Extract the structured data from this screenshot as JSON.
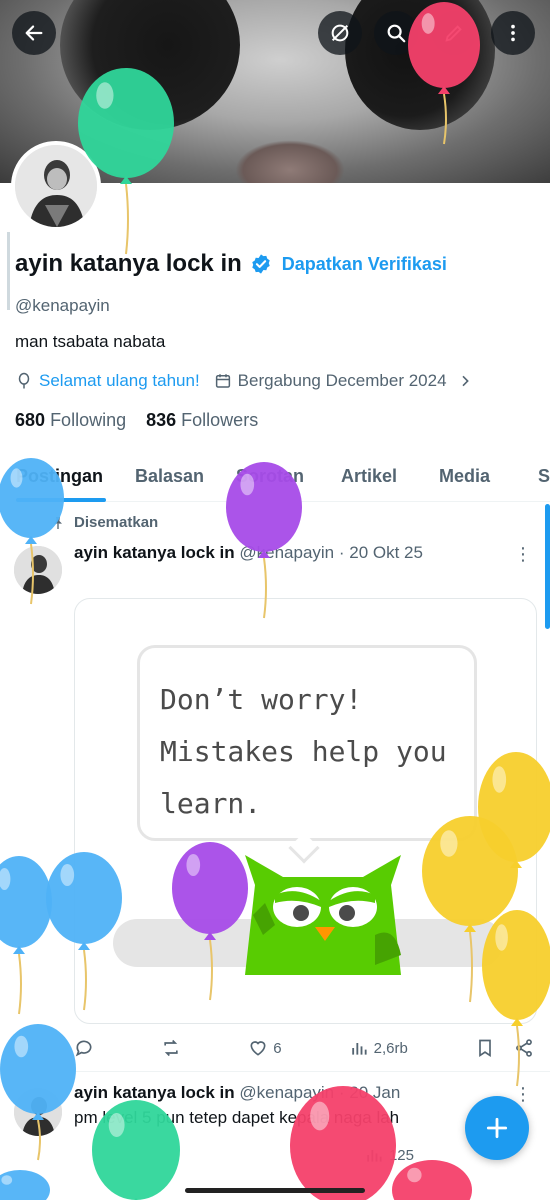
{
  "profile": {
    "name": "ayin katanya lock in",
    "verify_link": "Dapatkan Verifikasi",
    "handle": "@kenapayin",
    "bio": "man tsabata nabata",
    "birthday": "Selamat ulang tahun!",
    "joined": "Bergabung December 2024",
    "following_count": "680",
    "following_label": "Following",
    "followers_count": "836",
    "followers_label": "Followers"
  },
  "tabs": [
    "Postingan",
    "Balasan",
    "Sorotan",
    "Artikel",
    "Media",
    "S"
  ],
  "pinned_label": "Disematkan",
  "post1": {
    "name": "ayin katanya lock in",
    "handle_date": "@kenapayin · 20 Okt 25",
    "image_text_line1": "Don’t worry!",
    "image_text_line2": "Mistakes help you",
    "image_text_line3": "learn.",
    "likes": "6",
    "views": "2,6rb"
  },
  "post2": {
    "name": "ayin katanya lock in",
    "handle_date": "@kenapayin · 20 Jan",
    "text": "pm level 5 pun tetep dapet kepala naga lah",
    "views": "125"
  },
  "colors": {
    "accent": "#1d9bf0",
    "balloon_green": "#2fd69a",
    "balloon_red": "#f4406a",
    "balloon_purple": "#a64be8",
    "balloon_blue": "#4fb2f7",
    "balloon_yellow": "#f7cf2c",
    "owl_green": "#58cc02"
  },
  "icons": [
    "back-arrow-icon",
    "explore-icon",
    "search-icon",
    "edit-icon",
    "more-icon",
    "verified-badge-icon",
    "balloon-icon",
    "calendar-icon",
    "chevron-right-icon",
    "pin-icon",
    "reply-icon",
    "retweet-icon",
    "like-icon",
    "views-icon",
    "bookmark-icon",
    "share-icon",
    "compose-plus-icon"
  ]
}
